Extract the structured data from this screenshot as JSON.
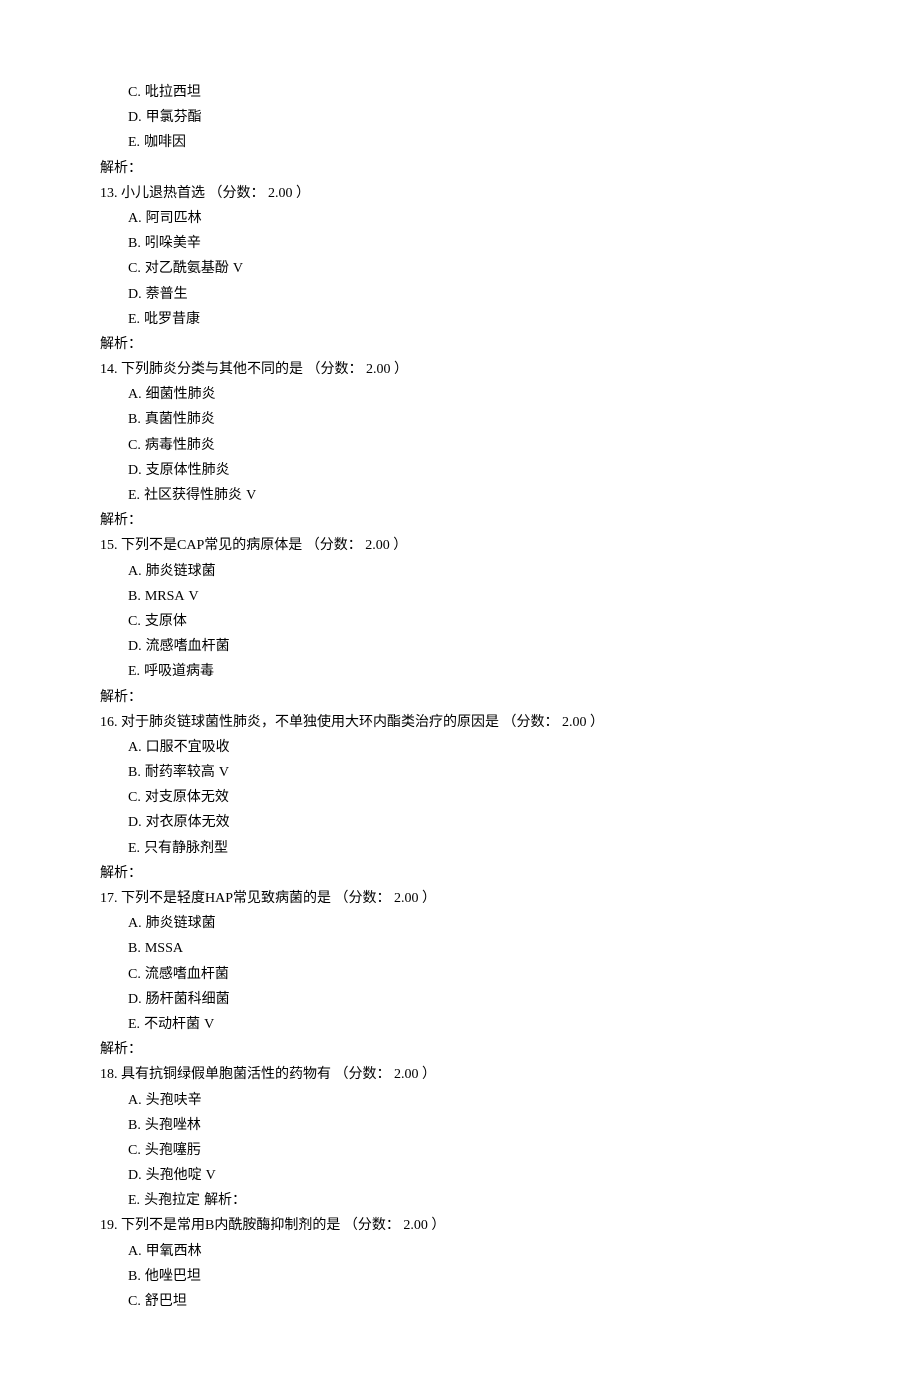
{
  "check_mark": "V",
  "analysis_label": "解析：",
  "score_prefix": "（分数：",
  "score_suffix": "）",
  "pre_options": [
    {
      "label": "C.",
      "text": "吡拉西坦",
      "correct": false
    },
    {
      "label": "D.",
      "text": "甲氯芬酯",
      "correct": false
    },
    {
      "label": "E.",
      "text": "咖啡因",
      "correct": false
    }
  ],
  "questions": [
    {
      "num": "13.",
      "stem": "小儿退热首选",
      "score": "2.00",
      "options": [
        {
          "label": "A.",
          "text": "阿司匹林",
          "correct": false
        },
        {
          "label": "B.",
          "text": "吲哚美辛",
          "correct": false
        },
        {
          "label": "C.",
          "text": "对乙酰氨基酚",
          "correct": true
        },
        {
          "label": "D.",
          "text": "萘普生",
          "correct": false
        },
        {
          "label": "E.",
          "text": "吡罗昔康",
          "correct": false
        }
      ],
      "inline_analysis": false
    },
    {
      "num": "14.",
      "stem": "下列肺炎分类与其他不同的是",
      "score": "2.00",
      "options": [
        {
          "label": "A.",
          "text": "细菌性肺炎",
          "correct": false
        },
        {
          "label": "B.",
          "text": "真菌性肺炎",
          "correct": false
        },
        {
          "label": "C.",
          "text": "病毒性肺炎",
          "correct": false
        },
        {
          "label": "D.",
          "text": "支原体性肺炎",
          "correct": false
        },
        {
          "label": "E.",
          "text": "社区获得性肺炎",
          "correct": true
        }
      ],
      "inline_analysis": false
    },
    {
      "num": "15.",
      "stem": "下列不是CAP常见的病原体是",
      "score": "2.00",
      "options": [
        {
          "label": "A.",
          "text": "肺炎链球菌",
          "correct": false
        },
        {
          "label": "B.",
          "text": "MRSA",
          "correct": true
        },
        {
          "label": "C.",
          "text": "支原体",
          "correct": false
        },
        {
          "label": "D.",
          "text": "流感嗜血杆菌",
          "correct": false
        },
        {
          "label": "E.",
          "text": "呼吸道病毒",
          "correct": false
        }
      ],
      "inline_analysis": false
    },
    {
      "num": "16.",
      "stem": "对于肺炎链球菌性肺炎，不单独使用大环内酯类治疗的原因是",
      "score": "2.00",
      "options": [
        {
          "label": "A.",
          "text": "口服不宜吸收",
          "correct": false
        },
        {
          "label": "B.",
          "text": "耐药率较高",
          "correct": true
        },
        {
          "label": "C.",
          "text": "对支原体无效",
          "correct": false
        },
        {
          "label": "D.",
          "text": "对衣原体无效",
          "correct": false
        },
        {
          "label": "E.",
          "text": "只有静脉剂型",
          "correct": false
        }
      ],
      "inline_analysis": false
    },
    {
      "num": "17.",
      "stem": "下列不是轻度HAP常见致病菌的是",
      "score": "2.00",
      "options": [
        {
          "label": "A.",
          "text": "肺炎链球菌",
          "correct": false
        },
        {
          "label": "B.",
          "text": "MSSA",
          "correct": false
        },
        {
          "label": "C.",
          "text": "流感嗜血杆菌",
          "correct": false
        },
        {
          "label": "D.",
          "text": "肠杆菌科细菌",
          "correct": false
        },
        {
          "label": "E.",
          "text": "不动杆菌",
          "correct": true
        }
      ],
      "inline_analysis": false
    },
    {
      "num": "18.",
      "stem": "具有抗铜绿假单胞菌活性的药物有",
      "score": "2.00",
      "options": [
        {
          "label": "A.",
          "text": "头孢呋辛",
          "correct": false
        },
        {
          "label": "B.",
          "text": "头孢唑林",
          "correct": false
        },
        {
          "label": "C.",
          "text": "头孢噻肟",
          "correct": false
        },
        {
          "label": "D.",
          "text": "头孢他啶",
          "correct": true
        },
        {
          "label": "E.",
          "text": "头孢拉定",
          "correct": false
        }
      ],
      "inline_analysis": true
    },
    {
      "num": "19.",
      "stem": "下列不是常用B内酰胺酶抑制剂的是",
      "score": "2.00",
      "options": [
        {
          "label": "A.",
          "text": "甲氧西林",
          "correct": false
        },
        {
          "label": "B.",
          "text": "他唑巴坦",
          "correct": false
        },
        {
          "label": "C.",
          "text": "舒巴坦",
          "correct": false
        }
      ],
      "inline_analysis": false,
      "no_analysis": true
    }
  ]
}
